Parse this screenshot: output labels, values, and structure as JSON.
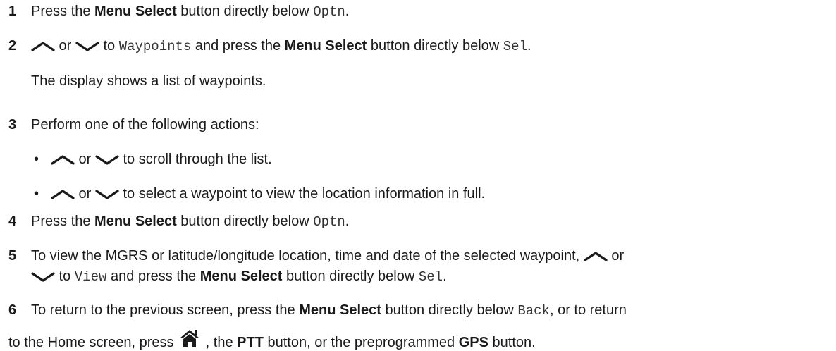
{
  "steps": [
    {
      "number": "1",
      "t1": "Press the ",
      "b1": "Menu Select",
      "t2": " button directly below ",
      "m1": "Optn",
      "t3": "."
    },
    {
      "number": "2",
      "or": " or ",
      "to": " to ",
      "m1": "Waypoints",
      "t2": " and press the ",
      "b1": "Menu Select",
      "t3": " button directly below ",
      "m2": "Sel",
      "t4": ".",
      "note": "The display shows a list of waypoints."
    },
    {
      "number": "3",
      "text": "Perform one of the following actions:",
      "bullets": [
        {
          "symbol": "•",
          "or": " or ",
          "text": " to scroll through the list."
        },
        {
          "symbol": "•",
          "or": " or ",
          "text": " to select a waypoint to view the location information in full."
        }
      ]
    },
    {
      "number": "4",
      "t1": "Press the ",
      "b1": "Menu Select",
      "t2": " button directly below ",
      "m1": "Optn",
      "t3": "."
    },
    {
      "number": "5",
      "t1": "To view the MGRS or latitude/longitude location, time and date of the selected waypoint, ",
      "or": " or",
      "to": " to ",
      "m1": "View",
      "t2": " and press the ",
      "b1": "Menu Select",
      "t3": " button directly below ",
      "m2": "Sel",
      "t4": "."
    },
    {
      "number": "6",
      "t1": "To return to the previous screen, press the ",
      "b1": "Menu Select",
      "t2": " button directly below ",
      "m1": "Back",
      "t3": ", or to return",
      "t4": "to the Home screen, press ",
      "t5": " , the ",
      "b2": "PTT",
      "t6": " button, or the preprogrammed ",
      "b3": "GPS",
      "t7": " button."
    }
  ],
  "icons": {
    "up": "chevron-up-icon",
    "down": "chevron-down-icon",
    "home": "home-icon"
  },
  "colors": {
    "text": "#1a1a1a",
    "mono": "#333333"
  }
}
